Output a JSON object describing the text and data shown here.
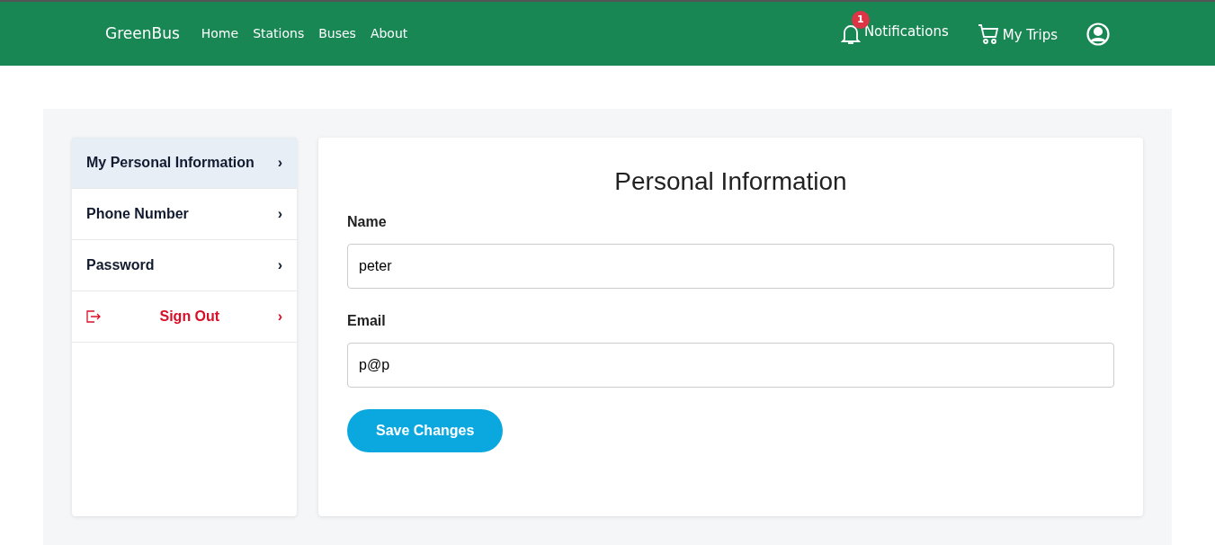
{
  "navbar": {
    "brand": "GreenBus",
    "links": [
      "Home",
      "Stations",
      "Buses",
      "About"
    ],
    "notifications": {
      "label": "Notifications",
      "count": "1"
    },
    "trips": {
      "label": "My Trips"
    }
  },
  "sidebar": {
    "items": [
      {
        "label": "My Personal Information",
        "kind": "link",
        "selected": true,
        "chevron": "›"
      },
      {
        "label": "Phone Number",
        "kind": "link",
        "selected": false,
        "chevron": "›"
      },
      {
        "label": "Password",
        "kind": "link",
        "selected": false,
        "chevron": "›"
      },
      {
        "label": "Sign Out",
        "kind": "signout",
        "selected": false,
        "chevron": "›"
      }
    ]
  },
  "form": {
    "title": "Personal Information",
    "fields": [
      {
        "label": "Name",
        "value": "peter"
      },
      {
        "label": "Email",
        "value": "p@p"
      }
    ],
    "button": "Save Changes"
  }
}
